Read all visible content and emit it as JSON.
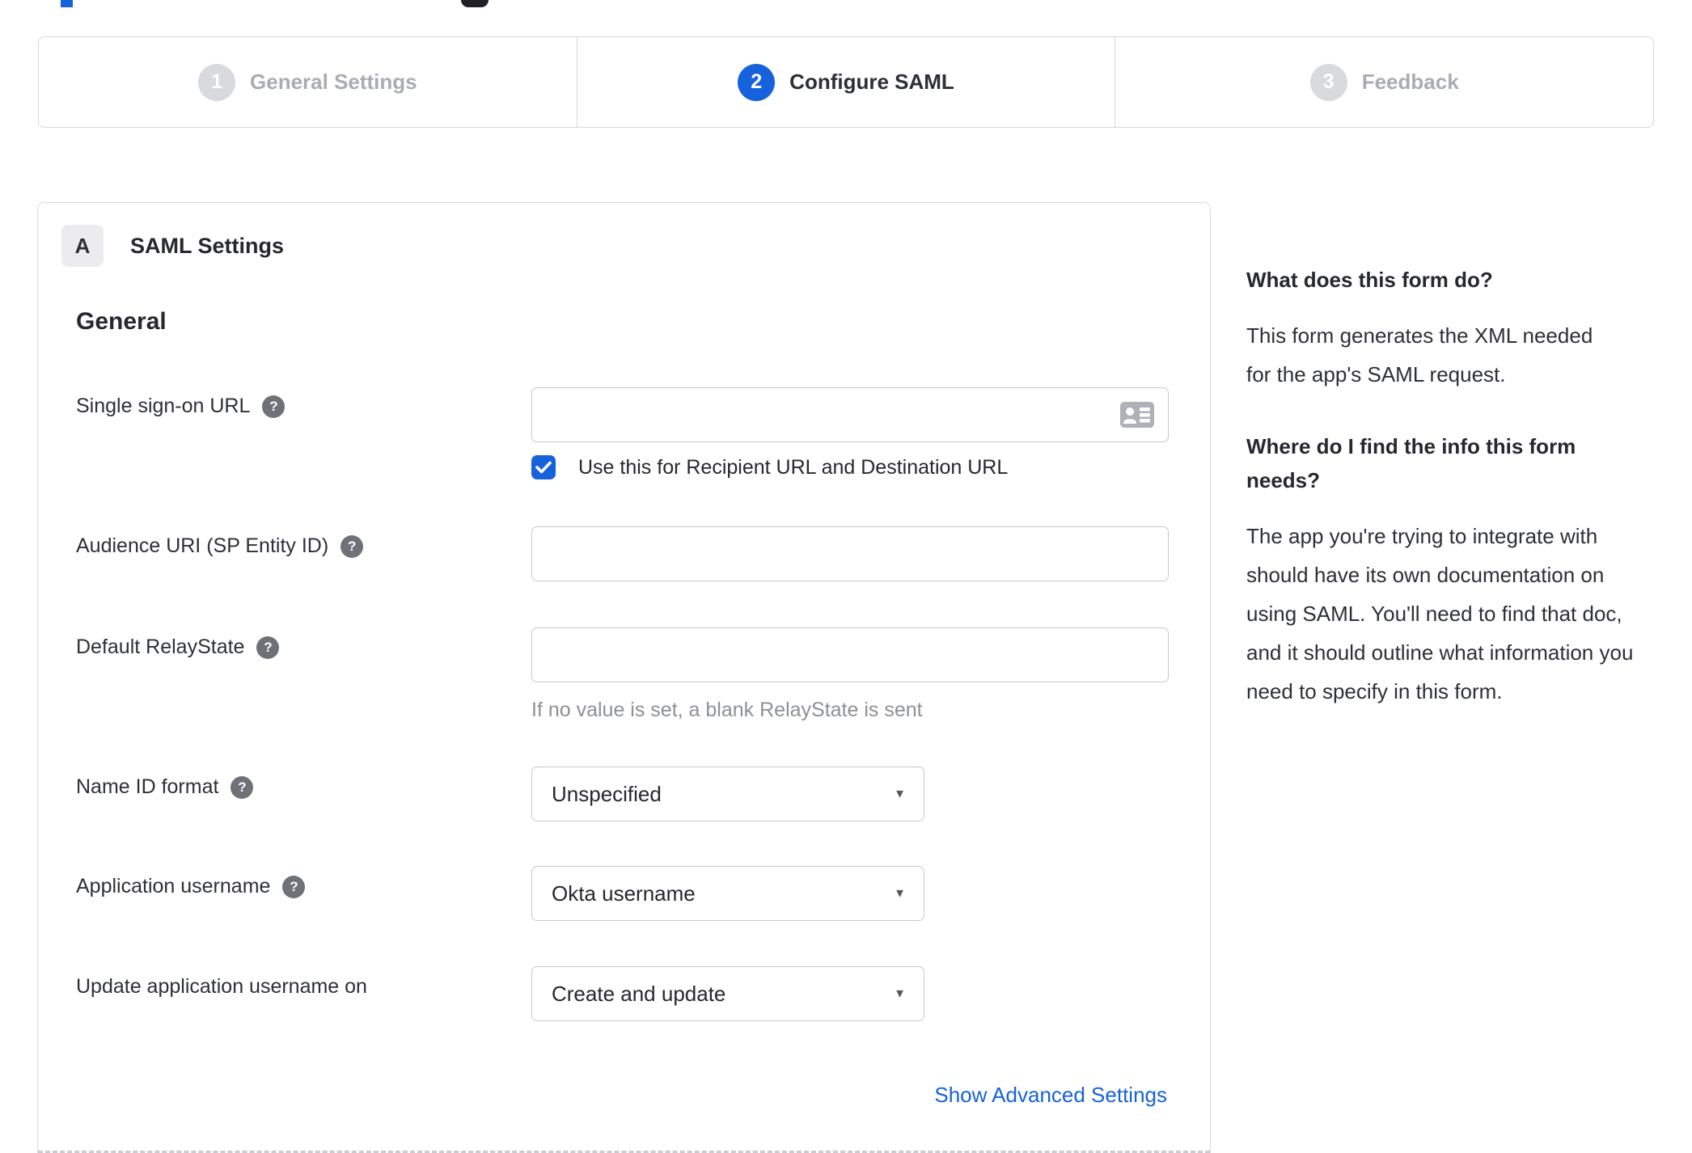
{
  "page": {
    "fragments": {
      "note": "cut-off header elements at top edge"
    },
    "steps": [
      {
        "number": "1",
        "label": "General Settings",
        "state": "inactive"
      },
      {
        "number": "2",
        "label": "Configure SAML",
        "state": "active"
      },
      {
        "number": "3",
        "label": "Feedback",
        "state": "inactive"
      }
    ],
    "card": {
      "badge": "A",
      "title": "SAML Settings",
      "section_heading": "General",
      "fields": [
        {
          "label": "Single sign-on URL",
          "type": "text-input",
          "value": "",
          "checkbox_label": "Use this for Recipient URL and Destination URL",
          "checkbox_checked": true
        },
        {
          "label": "Audience URI (SP Entity ID)",
          "type": "text-input",
          "value": ""
        },
        {
          "label": "Default RelayState",
          "type": "text-input",
          "value": "",
          "hint": "If no value is set, a blank RelayState is sent"
        },
        {
          "label": "Name ID format",
          "type": "select",
          "value": "Unspecified"
        },
        {
          "label": "Application username",
          "type": "select",
          "value": "Okta username"
        },
        {
          "label": "Update application username on",
          "type": "select",
          "value": "Create and update"
        }
      ],
      "advanced_link": "Show Advanced Settings"
    },
    "sidebar": {
      "sections": [
        {
          "heading": "What does this form do?",
          "body": "This form generates the XML needed for the app's SAML request."
        },
        {
          "heading": "Where do I find the info this form needs?",
          "body": "The app you're trying to integrate with should have its own documentation on using SAML. You'll need to find that doc, and it should outline what information you need to specify in this form."
        }
      ]
    },
    "icons": {
      "help_glyph": "?",
      "dropdown_arrow": "▼"
    },
    "colors": {
      "accent_blue": "#1662dd",
      "text_dark": "#2c2f36",
      "inactive_gray": "#a9acb2",
      "border_gray": "#d8d8dc",
      "hint_gray": "#8d9095",
      "help_icon_bg": "#6e7278"
    }
  }
}
